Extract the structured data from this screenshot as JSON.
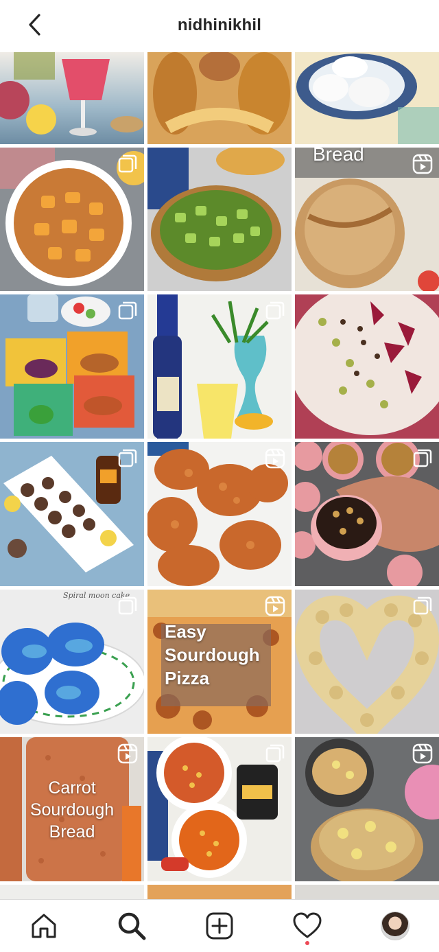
{
  "header": {
    "username": "nidhinikhil",
    "back_icon": "chevron-left-icon"
  },
  "grid": {
    "tiles": [
      {
        "name": "dragonfruit-drink",
        "badge": "",
        "overlay": "",
        "caption": ""
      },
      {
        "name": "braided-egg-bread",
        "badge": "",
        "overlay": "",
        "caption": ""
      },
      {
        "name": "idli-plate",
        "badge": "",
        "overlay": "",
        "caption": ""
      },
      {
        "name": "mango-upside-down-cake",
        "badge": "multiple-posts-icon",
        "overlay": "",
        "caption": ""
      },
      {
        "name": "okra-stir-fry",
        "badge": "",
        "overlay": "",
        "caption": ""
      },
      {
        "name": "sourdough-bread",
        "badge": "reels-icon",
        "overlay": "Bread",
        "caption": ""
      },
      {
        "name": "greek-meals-boxes",
        "badge": "multiple-posts-icon",
        "overlay": "",
        "caption": ""
      },
      {
        "name": "momokawa-sake-drink",
        "badge": "multiple-posts-icon",
        "overlay": "",
        "caption": ""
      },
      {
        "name": "smoothie-bowl",
        "badge": "",
        "overlay": "",
        "caption": ""
      },
      {
        "name": "mushroom-skewers",
        "badge": "multiple-posts-icon",
        "overlay": "",
        "caption": ""
      },
      {
        "name": "lentil-vada",
        "badge": "reels-icon",
        "overlay": "",
        "caption": ""
      },
      {
        "name": "chocolate-muffins",
        "badge": "multiple-posts-icon",
        "overlay": "",
        "caption": ""
      },
      {
        "name": "spiral-moon-cake",
        "badge": "multiple-posts-icon",
        "overlay": "",
        "caption": "Spiral moon cake"
      },
      {
        "name": "sourdough-pizza",
        "badge": "reels-icon",
        "overlay": "Easy Sourdough Pizza",
        "caption": ""
      },
      {
        "name": "heart-rose-bread",
        "badge": "multiple-posts-icon",
        "overlay": "",
        "caption": ""
      },
      {
        "name": "carrot-sourdough-bread",
        "badge": "reels-icon",
        "overlay": "Carrot Sourdough Bread",
        "caption": ""
      },
      {
        "name": "chickpea-soup",
        "badge": "multiple-posts-icon",
        "overlay": "",
        "caption": ""
      },
      {
        "name": "fruit-muffins",
        "badge": "reels-icon",
        "overlay": "",
        "caption": ""
      }
    ],
    "colors": {
      "row1": [
        "#c44d57",
        "#d9a35a",
        "#3d5b8c"
      ],
      "row2": [
        "#c97a36",
        "#6f9e3a",
        "#c99a63"
      ],
      "row3": [
        "#7fa3c4",
        "#2a3a8c",
        "#f1e6e0"
      ],
      "row4": [
        "#8fb4cf",
        "#c9682c",
        "#6b4a3a"
      ],
      "row5": [
        "#2f6fd0",
        "#d9893b",
        "#e6d29a"
      ],
      "row6": [
        "#c46a3e",
        "#d45a2a",
        "#d8b070"
      ]
    }
  },
  "tabbar": {
    "home": "home-icon",
    "search": "search-icon",
    "create": "add-post-icon",
    "activity": "heart-icon",
    "profile": "profile-avatar"
  }
}
